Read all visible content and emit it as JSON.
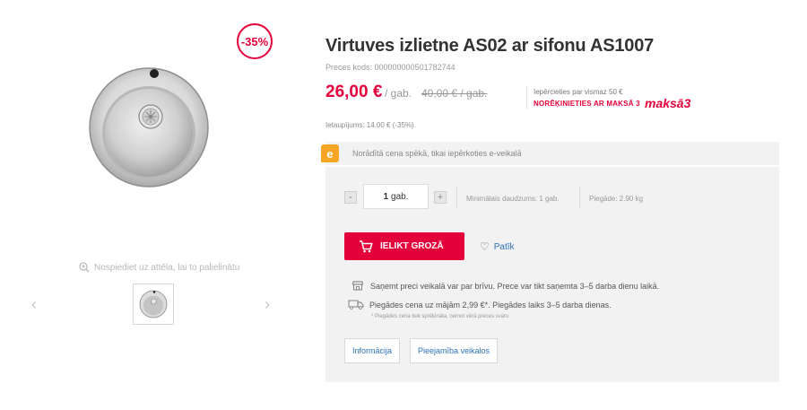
{
  "product": {
    "discount_badge": "-35%",
    "title": "Virtuves izlietne AS02 ar sifonu AS1007",
    "sku": "Preces kods: 000000000501782744",
    "price": "26,00 €",
    "unit": "/ gab.",
    "old_price": "40,00 € / gab.",
    "savings": "Ietaupījums: 14,00 € (-35%)."
  },
  "gallery": {
    "zoom_hint": "Nospiediet uz attēla, lai to palielinātu",
    "prev_arrow": "‹",
    "next_arrow": "›"
  },
  "installment": {
    "note": "Iepērcieties par vismaz 50 €",
    "link": "NORĒĶINIETIES AR MAKSĀ 3",
    "logo_text": "maksā3"
  },
  "eshop_banner": {
    "icon": "e",
    "text": "Norādītā cena spēkā, tikai iepērkoties e-veikalā"
  },
  "buy_box": {
    "qty_minus": "-",
    "qty_value": "1",
    "qty_unit": "gab.",
    "qty_plus": "+",
    "min_qty": "Minimālais daudzums: 1 gab.",
    "weight": "Piegāde: 2.90 kg",
    "add_to_cart": "IELIKT GROZĀ",
    "like": "Patīk",
    "store_pickup": "Saņemt preci veikalā var par brīvu. Prece var tikt saņemta 3–5 darba dienu laikā.",
    "home_delivery": "Piegādes cena uz mājām 2,99 €*. Piegādes laiks 3–5 darba dienas.",
    "delivery_note": "* Piegādes cena tiek sprēķināta, ņemot vērā preces svaru"
  },
  "tabs": [
    {
      "label": "Informācija"
    },
    {
      "label": "Pieejamība veikalos"
    }
  ],
  "colors": {
    "accent_red": "#e4003a",
    "link_blue": "#2b73b8",
    "eshop_orange": "#f6a623",
    "panel_gray": "#f2f2f2"
  },
  "icons": {
    "zoom": "magnifier-plus-icon",
    "cart": "cart-icon",
    "heart": "heart-outline-icon",
    "store": "store-icon",
    "truck": "truck-icon"
  }
}
